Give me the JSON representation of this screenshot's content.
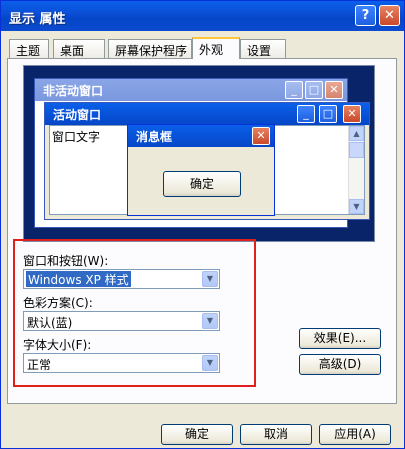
{
  "window": {
    "title": "显示 属性",
    "help": "?",
    "close": "✕"
  },
  "tabs": [
    {
      "label": "主题"
    },
    {
      "label": "桌面"
    },
    {
      "label": "屏幕保护程序"
    },
    {
      "label": "外观"
    },
    {
      "label": "设置"
    }
  ],
  "preview": {
    "inactive_title": "非活动窗口",
    "active_title": "活动窗口",
    "window_text": "窗口文字",
    "msgbox_title": "消息框",
    "msgbox_ok": "确定",
    "min": "_",
    "max": "□",
    "close": "✕"
  },
  "settings": {
    "windows_buttons_label": "窗口和按钮(W):",
    "windows_buttons_value": "Windows XP 样式",
    "color_scheme_label": "色彩方案(C):",
    "color_scheme_value": "默认(蓝)",
    "font_size_label": "字体大小(F):",
    "font_size_value": "正常"
  },
  "side_buttons": {
    "effects": "效果(E)...",
    "advanced": "高级(D)"
  },
  "footer": {
    "ok": "确定",
    "cancel": "取消",
    "apply": "应用(A)"
  }
}
